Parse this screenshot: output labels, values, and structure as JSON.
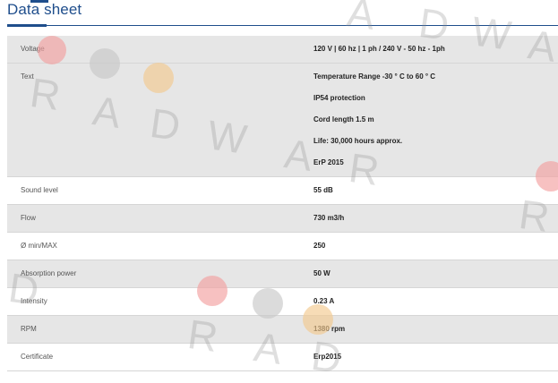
{
  "section": {
    "title": "Data sheet"
  },
  "rows": [
    {
      "label": "Voltage",
      "values": [
        "120 V | 60 hz | 1 ph / 240 V - 50 hz - 1ph"
      ]
    },
    {
      "label": "Text",
      "values": [
        "Temperature Range -30 ° C to 60 ° C",
        "IP54 protection",
        "Cord length 1.5 m",
        "Life: 30,000 hours approx.",
        "ErP 2015"
      ]
    },
    {
      "label": "Sound level",
      "values": [
        "55 dB"
      ]
    },
    {
      "label": "Flow",
      "values": [
        "730 m3/h"
      ]
    },
    {
      "label": "Ø min/MAX",
      "values": [
        "250"
      ]
    },
    {
      "label": "Absorption power",
      "values": [
        "50 W"
      ]
    },
    {
      "label": "Intensity",
      "values": [
        "0.23 A"
      ]
    },
    {
      "label": "RPM",
      "values": [
        "1380 rpm"
      ]
    },
    {
      "label": "Certificate",
      "values": [
        "Erp2015"
      ]
    }
  ],
  "watermark": {
    "text": "RADWARD",
    "colors": {
      "red": "#f2a0a0",
      "grey": "#c8c8c8",
      "orange": "#f3c98f"
    }
  },
  "theme": {
    "accent": "#1f4e8c",
    "row_alt": "#e6e6e6"
  }
}
